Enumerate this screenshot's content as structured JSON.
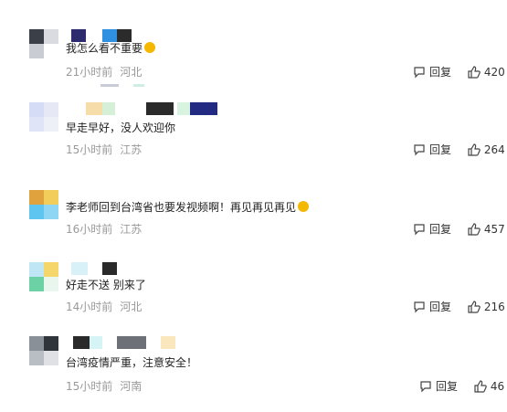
{
  "comments": [
    {
      "text": "我怎么看不重要",
      "time": "21小时前",
      "location": "河北",
      "reply_label": "回复",
      "likes": "420",
      "emoji": "worried-face-emoji"
    },
    {
      "text": "早走早好，没人欢迎你",
      "time": "15小时前",
      "location": "江苏",
      "reply_label": "回复",
      "likes": "264"
    },
    {
      "text": "李老师回到台湾省也要发视频啊！再见再见再见",
      "time": "16小时前",
      "location": "江苏",
      "reply_label": "回复",
      "likes": "457",
      "emoji": "laughing-face-emoji"
    },
    {
      "text": "好走不送 别来了",
      "time": "14小时前",
      "location": "河北",
      "reply_label": "回复",
      "likes": "216"
    },
    {
      "text": "台湾疫情严重，注意安全！",
      "time": "15小时前",
      "location": "河南",
      "reply_label": "回复",
      "likes": "46"
    }
  ],
  "colors": {
    "accent_emoji": "#f5b800",
    "meta": "#999999",
    "text": "#222222"
  }
}
